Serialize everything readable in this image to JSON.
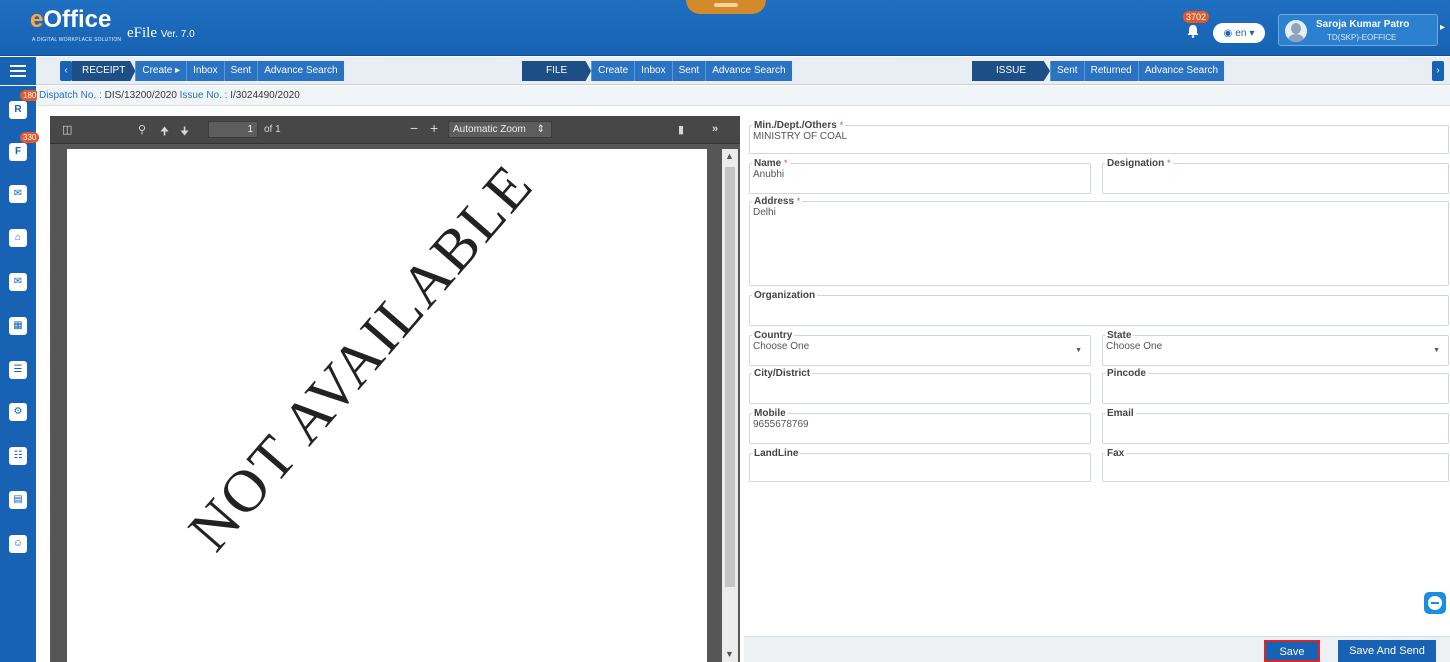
{
  "header": {
    "logo_e": "e",
    "logo_office": "Office",
    "logo_tagline": "A DIGITAL WORKPLACE SOLUTION",
    "app_name": "eFile",
    "version": "Ver. 7.0",
    "notification_count": "3702",
    "language": "en",
    "user_name": "Saroja Kumar Patro",
    "user_id": "TD(SKP)-EOFFICE"
  },
  "toolbar": {
    "receipt": {
      "label": "RECEIPT",
      "items": [
        "Create ▸",
        "Inbox",
        "Sent",
        "Advance Search"
      ]
    },
    "file": {
      "label": "FILE",
      "items": [
        "Create",
        "Inbox",
        "Sent",
        "Advance Search"
      ]
    },
    "issue": {
      "label": "ISSUE",
      "items": [
        "Sent",
        "Returned",
        "Advance Search"
      ]
    }
  },
  "sidebar": {
    "items": [
      {
        "icon": "receipt-icon",
        "glyph": "R",
        "badge": "180"
      },
      {
        "icon": "file-icon",
        "glyph": "F",
        "badge": "330"
      },
      {
        "icon": "dispatch-icon",
        "glyph": "✉",
        "badge": ""
      },
      {
        "icon": "home-icon",
        "glyph": "⌂",
        "badge": ""
      },
      {
        "icon": "mail-icon",
        "glyph": "✉",
        "badge": ""
      },
      {
        "icon": "contacts-icon",
        "glyph": "▦",
        "badge": ""
      },
      {
        "icon": "documents-icon",
        "glyph": "☰",
        "badge": ""
      },
      {
        "icon": "settings-icon",
        "glyph": "⚙",
        "badge": ""
      },
      {
        "icon": "reports-icon",
        "glyph": "☷",
        "badge": ""
      },
      {
        "icon": "log-icon",
        "glyph": "▤",
        "badge": ""
      },
      {
        "icon": "users-icon",
        "glyph": "☺",
        "badge": ""
      }
    ]
  },
  "dispatch": {
    "dispatch_label": "Dispatch No. :",
    "dispatch_no": "DIS/13200/2020",
    "issue_label": "Issue No. :",
    "issue_no": "I/3024490/2020"
  },
  "pdf": {
    "page_number": "1",
    "page_total": "of 1",
    "zoom": "Automatic Zoom",
    "watermark": "NOT AVAILABLE"
  },
  "form": {
    "ministry": {
      "label": "Min./Dept./Others",
      "value": "MINISTRY OF COAL"
    },
    "name": {
      "label": "Name",
      "value": "Anubhi"
    },
    "designation": {
      "label": "Designation",
      "value": ""
    },
    "address": {
      "label": "Address",
      "value": "Delhi"
    },
    "organization": {
      "label": "Organization",
      "value": ""
    },
    "country": {
      "label": "Country",
      "value": "Choose One"
    },
    "state": {
      "label": "State",
      "value": "Choose One"
    },
    "city": {
      "label": "City/District",
      "value": ""
    },
    "pincode": {
      "label": "Pincode",
      "value": ""
    },
    "mobile": {
      "label": "Mobile",
      "value": "9655678769"
    },
    "email": {
      "label": "Email",
      "value": ""
    },
    "landline": {
      "label": "LandLine",
      "value": ""
    },
    "fax": {
      "label": "Fax",
      "value": ""
    },
    "required_mark": "*"
  },
  "buttons": {
    "save": "Save",
    "save_and_send": "Save And Send"
  }
}
